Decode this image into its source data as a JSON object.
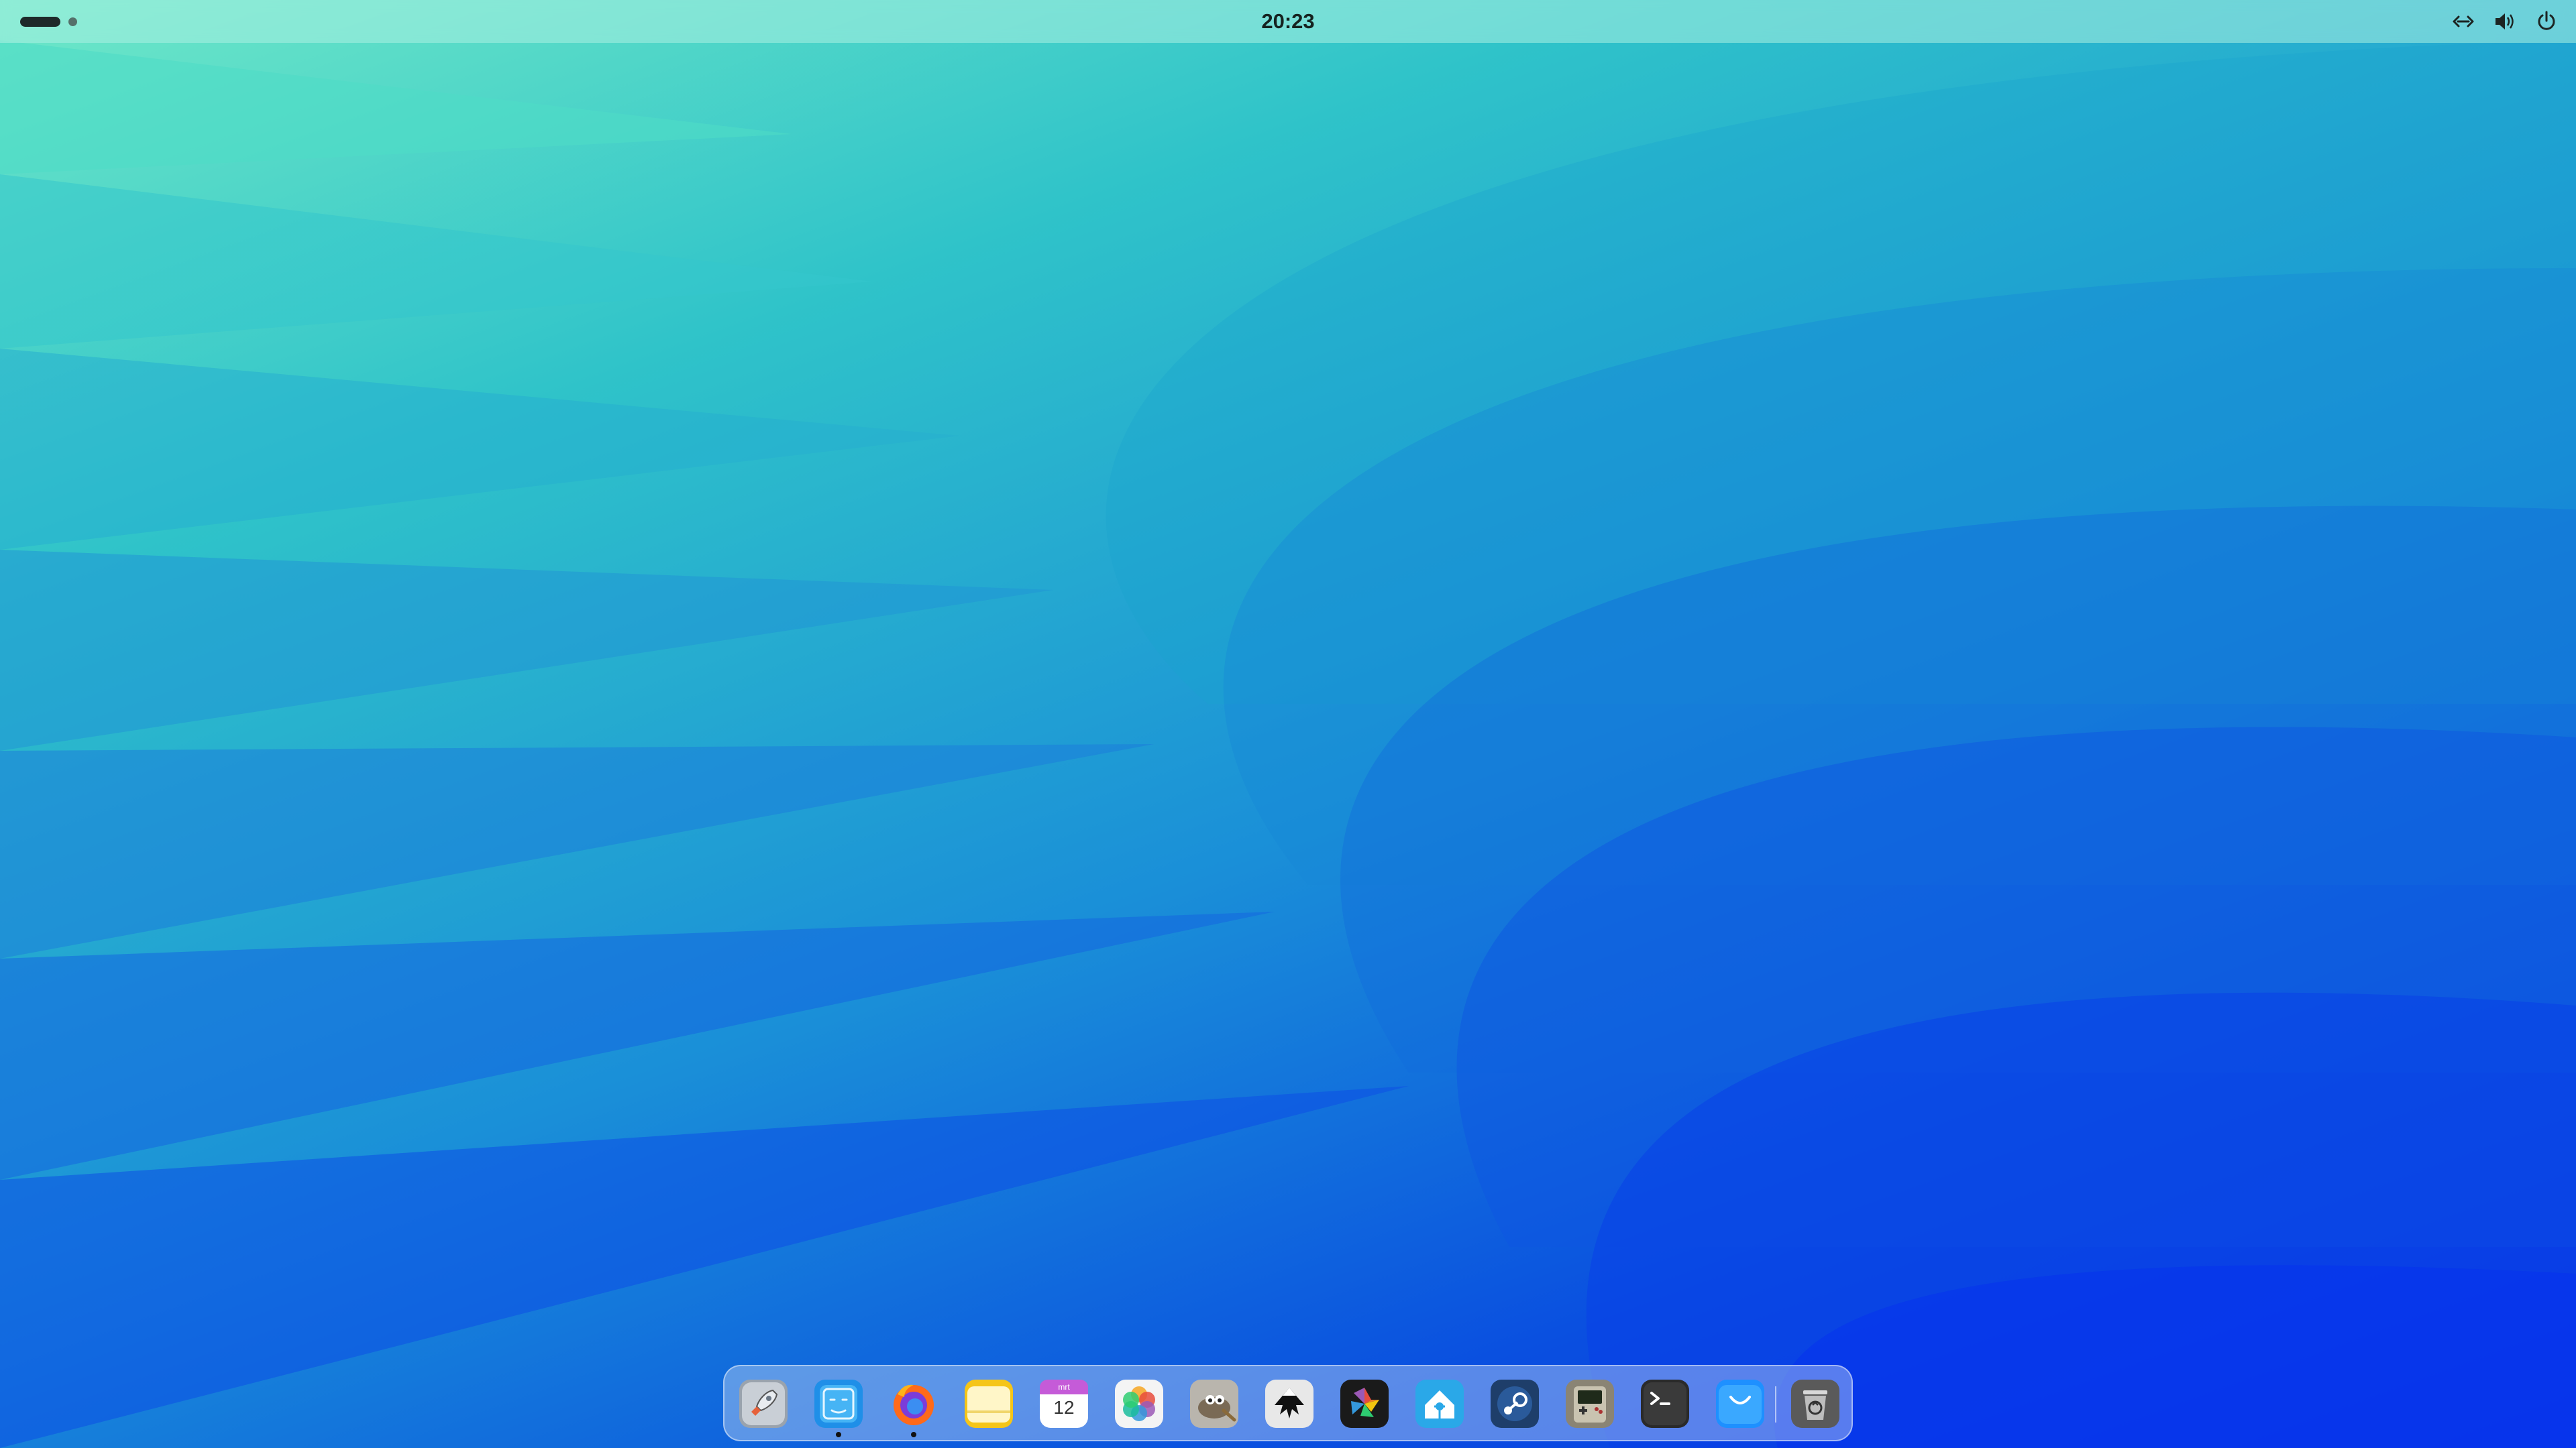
{
  "topbar": {
    "clock": "20:23",
    "workspaces": [
      "workspace-1",
      "workspace-2"
    ],
    "tray_icons": [
      "network-wired-icon",
      "volume-icon",
      "power-icon"
    ]
  },
  "dock": {
    "items": [
      {
        "name": "launchpad",
        "icon": "rocket-icon",
        "running": false
      },
      {
        "name": "files",
        "icon": "finder-icon",
        "running": true
      },
      {
        "name": "firefox",
        "icon": "firefox-icon",
        "running": true
      },
      {
        "name": "notes",
        "icon": "notes-icon",
        "running": false
      },
      {
        "name": "calendar",
        "icon": "calendar-icon",
        "running": false,
        "month": "mrt",
        "day": "12"
      },
      {
        "name": "photos",
        "icon": "photos-icon",
        "running": false
      },
      {
        "name": "gimp",
        "icon": "gimp-icon",
        "running": false
      },
      {
        "name": "inkscape",
        "icon": "inkscape-icon",
        "running": false
      },
      {
        "name": "darktable",
        "icon": "aperture-icon",
        "running": false
      },
      {
        "name": "home-assistant",
        "icon": "home-assistant-icon",
        "running": false
      },
      {
        "name": "steam",
        "icon": "steam-icon",
        "running": false
      },
      {
        "name": "gameboy",
        "icon": "gameboy-icon",
        "running": false
      },
      {
        "name": "terminal",
        "icon": "terminal-icon",
        "running": false
      },
      {
        "name": "app-store",
        "icon": "store-bag-icon",
        "running": false
      },
      {
        "name": "trash",
        "icon": "trash-icon",
        "running": false
      }
    ]
  },
  "colors": {
    "topbar": "#aaf0e1",
    "wallpaper_light": "#6fe8c8",
    "wallpaper_dark": "#0a2fe8"
  }
}
